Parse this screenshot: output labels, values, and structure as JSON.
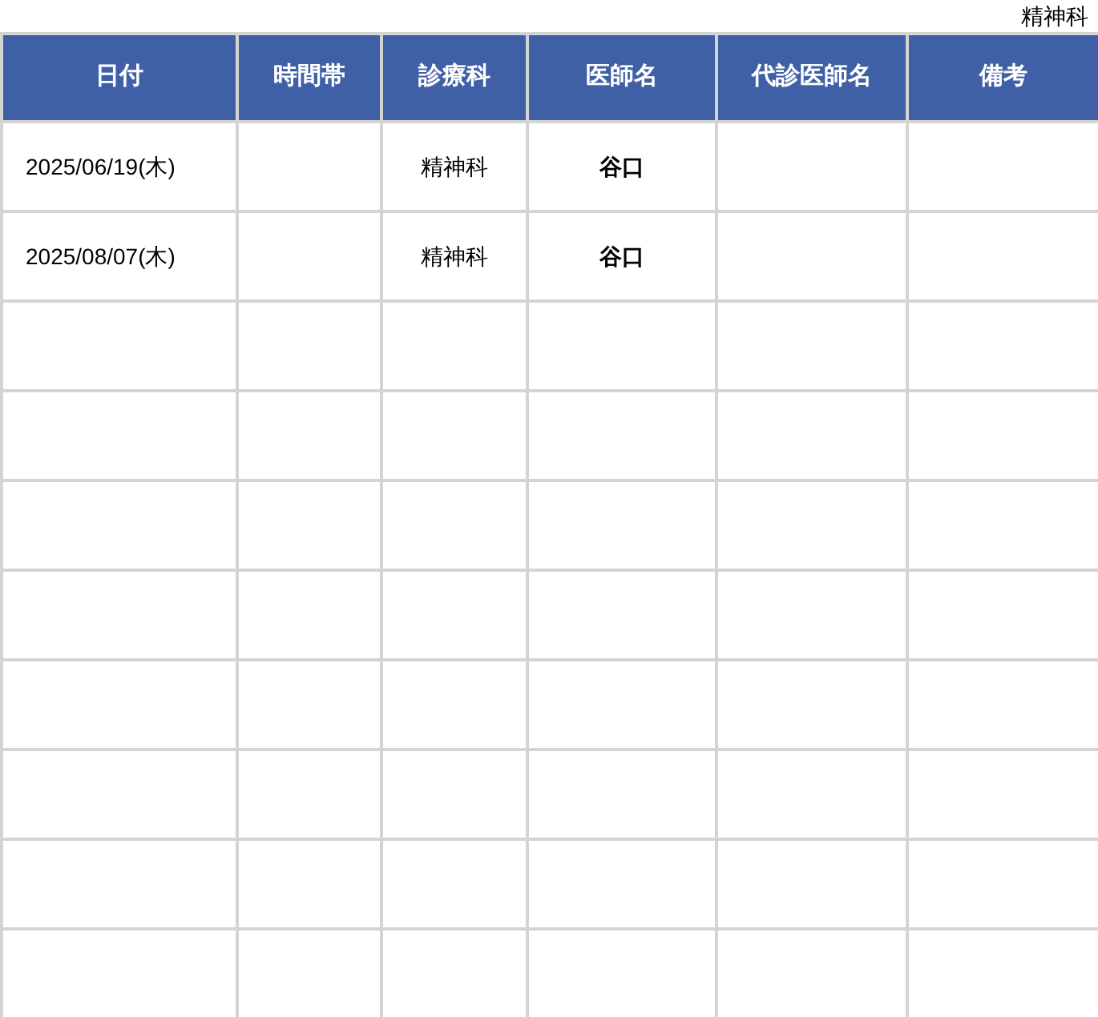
{
  "department_label": "精神科",
  "table": {
    "columns": [
      "日付",
      "時間帯",
      "診療科",
      "医師名",
      "代診医師名",
      "備考"
    ],
    "rows": [
      {
        "date": "2025/06/19(木)",
        "department": "精神科",
        "doctor": "谷口"
      },
      {
        "date": "2025/08/07(木)",
        "department": "精神科",
        "doctor": "谷口"
      }
    ]
  }
}
